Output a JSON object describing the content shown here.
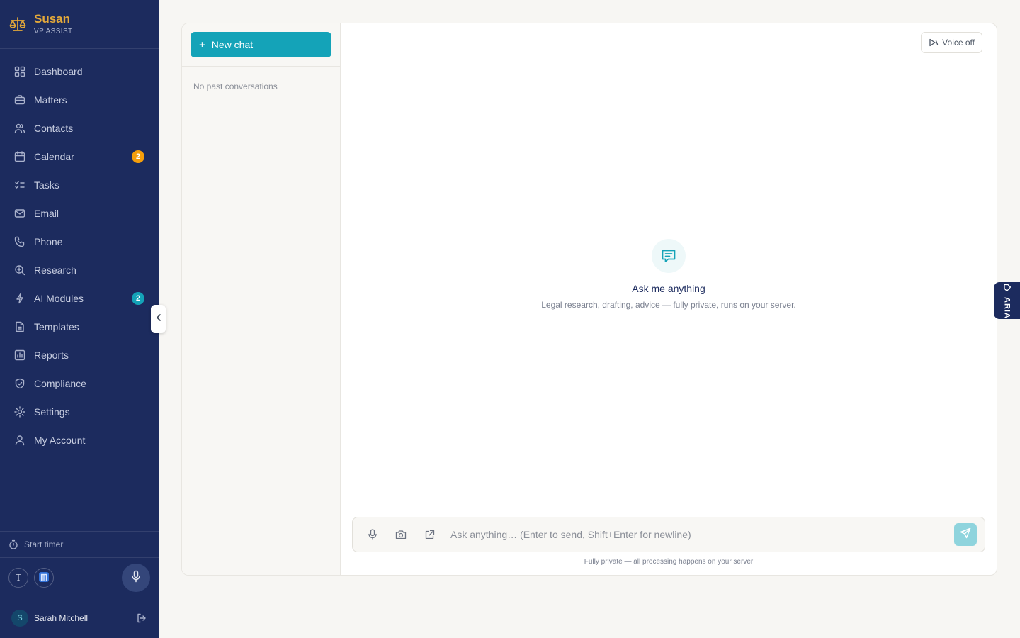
{
  "brand": {
    "name": "Susan",
    "subtitle": "VP ASSIST",
    "accent": "#e4a93a"
  },
  "sidebar": {
    "items": [
      {
        "label": "Dashboard",
        "icon": "grid-icon"
      },
      {
        "label": "Matters",
        "icon": "briefcase-icon"
      },
      {
        "label": "Contacts",
        "icon": "users-icon"
      },
      {
        "label": "Calendar",
        "icon": "calendar-icon",
        "badge": "2"
      },
      {
        "label": "Tasks",
        "icon": "checklist-icon"
      },
      {
        "label": "Email",
        "icon": "mail-icon"
      },
      {
        "label": "Phone",
        "icon": "phone-icon"
      },
      {
        "label": "Research",
        "icon": "search-zoom-icon"
      },
      {
        "label": "AI Modules",
        "icon": "lightning-icon",
        "badge": "2"
      },
      {
        "label": "Templates",
        "icon": "document-icon"
      },
      {
        "label": "Reports",
        "icon": "bar-chart-icon"
      },
      {
        "label": "Compliance",
        "icon": "shield-icon"
      },
      {
        "label": "Settings",
        "icon": "gear-icon"
      },
      {
        "label": "My Account",
        "icon": "user-icon"
      }
    ],
    "timer_label": "Start timer",
    "tool_t": "T",
    "user": {
      "initial": "S",
      "name": "Sarah Mitchell"
    }
  },
  "history": {
    "new_chat_label": "New chat",
    "empty_label": "No past conversations"
  },
  "chat": {
    "voice_label": "Voice off",
    "empty_title": "Ask me anything",
    "empty_desc": "Legal research, drafting, advice — fully private, runs on your server.",
    "input_placeholder": "Ask anything… (Enter to send, Shift+Enter for newline)",
    "footnote": "Fully private — all processing happens on your server"
  },
  "aria": {
    "label": "ARIA"
  },
  "colors": {
    "sidebar": "#1c2b5e",
    "teal": "#14a3b8",
    "orange": "#f59e0b"
  }
}
